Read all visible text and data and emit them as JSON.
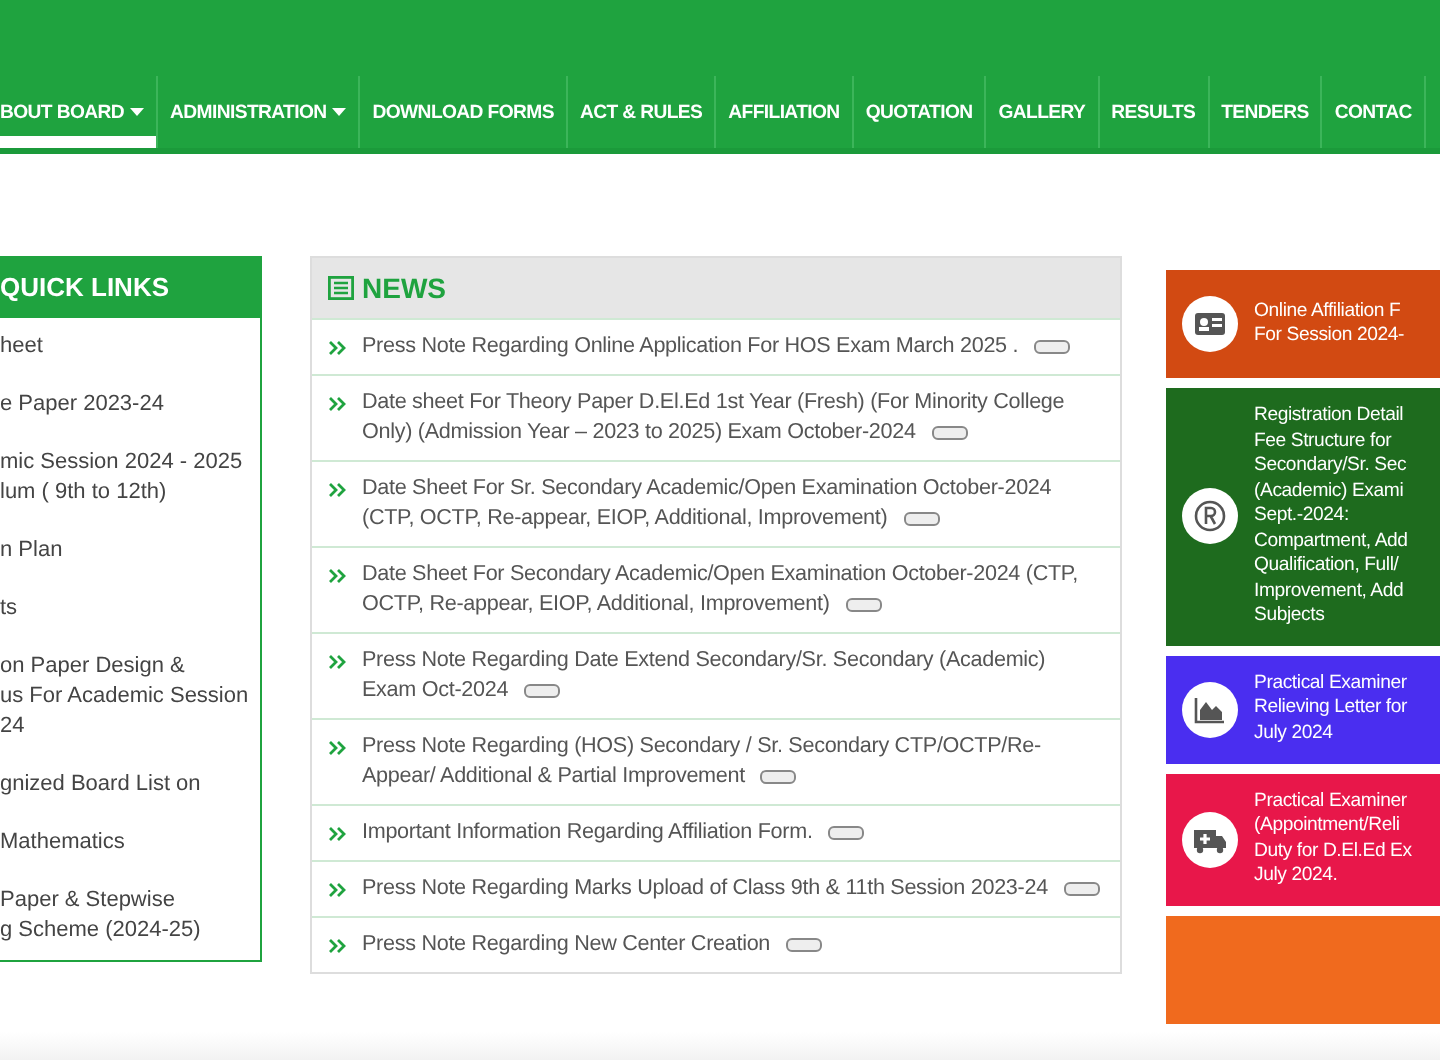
{
  "nav": [
    {
      "label": "BOUT BOARD",
      "dropdown": true,
      "selected": true
    },
    {
      "label": "ADMINISTRATION",
      "dropdown": true,
      "selected": false
    },
    {
      "label": "DOWNLOAD FORMS",
      "dropdown": false,
      "selected": false
    },
    {
      "label": "ACT & RULES",
      "dropdown": false,
      "selected": false
    },
    {
      "label": "AFFILIATION",
      "dropdown": false,
      "selected": false
    },
    {
      "label": "QUOTATION",
      "dropdown": false,
      "selected": false
    },
    {
      "label": "GALLERY",
      "dropdown": false,
      "selected": false
    },
    {
      "label": "RESULTS",
      "dropdown": false,
      "selected": false
    },
    {
      "label": "TENDERS",
      "dropdown": false,
      "selected": false
    },
    {
      "label": "CONTAC",
      "dropdown": false,
      "selected": false
    }
  ],
  "quick_links": {
    "title": "QUICK LINKS",
    "items": [
      {
        "lines": [
          "heet"
        ]
      },
      {
        "lines": [
          "e Paper 2023-24"
        ]
      },
      {
        "lines": [
          "mic Session 2024 - 2025",
          "lum ( 9th to 12th)"
        ]
      },
      {
        "lines": [
          "n Plan"
        ]
      },
      {
        "lines": [
          "ts"
        ]
      },
      {
        "lines": [
          "on Paper Design &",
          "us For Academic Session",
          "24"
        ]
      },
      {
        "lines": [
          "gnized Board List on"
        ]
      },
      {
        "lines": [
          "Mathematics"
        ]
      },
      {
        "lines": [
          "Paper & Stepwise",
          "g Scheme (2024-25)"
        ]
      }
    ]
  },
  "news": {
    "title": "NEWS",
    "items": [
      {
        "text": "Press Note Regarding Online Application For HOS Exam March 2025 .",
        "new": true
      },
      {
        "text": "Date sheet For Theory Paper D.El.Ed 1st Year (Fresh) (For Minority College Only) (Admission Year – 2023 to 2025) Exam October-2024",
        "new": true
      },
      {
        "text": "Date Sheet For Sr. Secondary Academic/Open Examination October-2024 (CTP, OCTP, Re-appear, EIOP, Additional, Improvement)",
        "new": true
      },
      {
        "text": "Date Sheet For Secondary Academic/Open Examination October-2024 (CTP, OCTP, Re-appear, EIOP, Additional, Improvement)",
        "new": true
      },
      {
        "text": "Press Note Regarding Date Extend Secondary/Sr. Secondary (Academic) Exam Oct-2024",
        "new": true
      },
      {
        "text": "Press Note Regarding (HOS) Secondary / Sr. Secondary CTP/OCTP/Re-Appear/ Additional & Partial Improvement",
        "new": true
      },
      {
        "text": "Important Information Regarding Affiliation Form.",
        "new": true
      },
      {
        "text": "Press Note Regarding Marks Upload of Class 9th & 11th Session 2023-24",
        "new": true
      },
      {
        "text": "Press Note Regarding New Center Creation",
        "new": true
      }
    ]
  },
  "cards": [
    {
      "kind": "id-card",
      "color": "#d24a12",
      "lines": [
        "Online Affiliation F",
        "For Session 2024-"
      ]
    },
    {
      "kind": "registered",
      "color": "#1e6b1e",
      "lines": [
        "Registration Detail",
        "Fee Structure for",
        "Secondary/Sr. Sec",
        "(Academic) Exami",
        "Sept.-2024:",
        "Compartment, Add",
        "Qualification, Full/",
        "Improvement, Add",
        "Subjects"
      ]
    },
    {
      "kind": "chart",
      "color": "#4a2ef0",
      "lines": [
        "Practical Examiner",
        "Relieving Letter for",
        "July 2024"
      ]
    },
    {
      "kind": "ambulance",
      "color": "#e8174a",
      "lines": [
        "Practical Examiner",
        "(Appointment/Reli",
        "Duty for D.El.Ed Ex",
        "July 2024."
      ]
    },
    {
      "kind": "blank",
      "color": "#f06a1e"
    }
  ]
}
